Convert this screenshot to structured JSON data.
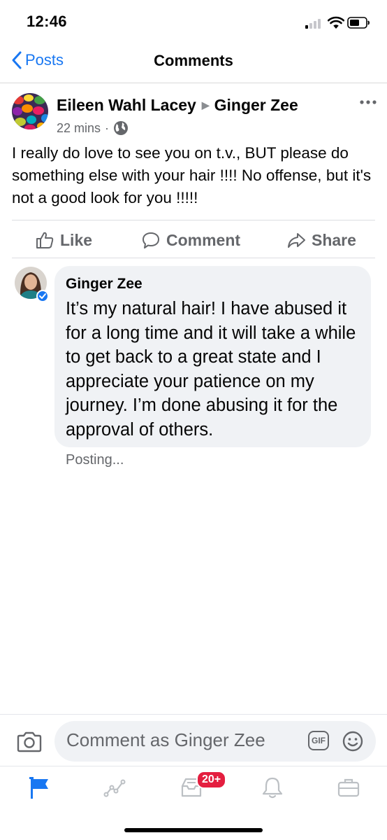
{
  "status_bar": {
    "time": "12:46"
  },
  "nav": {
    "back_label": "Posts",
    "title": "Comments"
  },
  "post": {
    "author": "Eileen Wahl Lacey",
    "target": "Ginger Zee",
    "time": "22 mins",
    "text": "I really do love to see you on t.v., BUT please do something else with your hair !!!!  No offense, but it's not a good look for you !!!!!"
  },
  "actions": {
    "like": "Like",
    "comment": "Comment",
    "share": "Share"
  },
  "reply": {
    "author": "Ginger Zee",
    "text": "It’s my natural hair! I have abused it for a long time and it will take a while to get back to a great state and I appreciate your patience on my journey. I’m done abusing it for the approval of others.",
    "status": "Posting..."
  },
  "composer": {
    "placeholder": "Comment as Ginger Zee",
    "gif_label": "GIF"
  },
  "tabbar": {
    "notifications_badge": "20+"
  },
  "colors": {
    "accent": "#1877f2",
    "badge": "#e41e3f",
    "secondary_text": "#65676b"
  }
}
